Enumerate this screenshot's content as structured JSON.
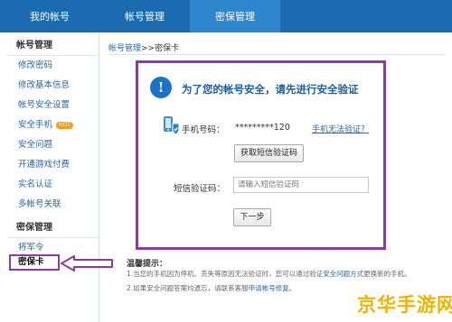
{
  "topnav": {
    "tabs": [
      {
        "label": "我的帐号"
      },
      {
        "label": "帐号管理"
      },
      {
        "label": "密保管理"
      }
    ]
  },
  "sidebar": {
    "heading1": "帐号管理",
    "items1": [
      {
        "label": "修改密码"
      },
      {
        "label": "修改基本信息"
      },
      {
        "label": "帐号安全设置"
      },
      {
        "label": "安全手机",
        "badge": "HOT"
      },
      {
        "label": "安全问题"
      },
      {
        "label": "开通游戏付费"
      },
      {
        "label": "实名认证"
      },
      {
        "label": "多帐号关联"
      }
    ],
    "heading2": "密保管理",
    "items2": [
      {
        "label": "将军令"
      },
      {
        "label": "密保卡"
      }
    ]
  },
  "breadcrumb": {
    "link": "帐号管理",
    "current": ">>密保卡"
  },
  "panel": {
    "heading": "为了您的帐号安全，请先进行安全验证",
    "phone_label": "手机号码：",
    "phone_value": "*********120",
    "phone_link": "手机无法验证？",
    "get_code_button": "获取短信验证码",
    "sms_label": "短信验证码：",
    "sms_placeholder": "请输入短信验证码",
    "next_button": "下一步"
  },
  "tips": {
    "title": "温馨提示：",
    "tip1_text": "1.当您的手机因为停机、丢失等原因无法验证时，您可以通过验证",
    "tip1_link": "安全问题方式",
    "tip1_end": "更换新的手机。",
    "tip2_text": "2.如果安全问题答案均遗忘，请联系客服",
    "tip2_link": "申请帐号修复",
    "tip2_end": "。"
  },
  "watermark": {
    "text": "京华手游网"
  },
  "colors": {
    "nav": "#1b6bb0",
    "nav_active": "#2e86cf",
    "highlight": "#8e3aa3",
    "link": "#2a64a8"
  }
}
